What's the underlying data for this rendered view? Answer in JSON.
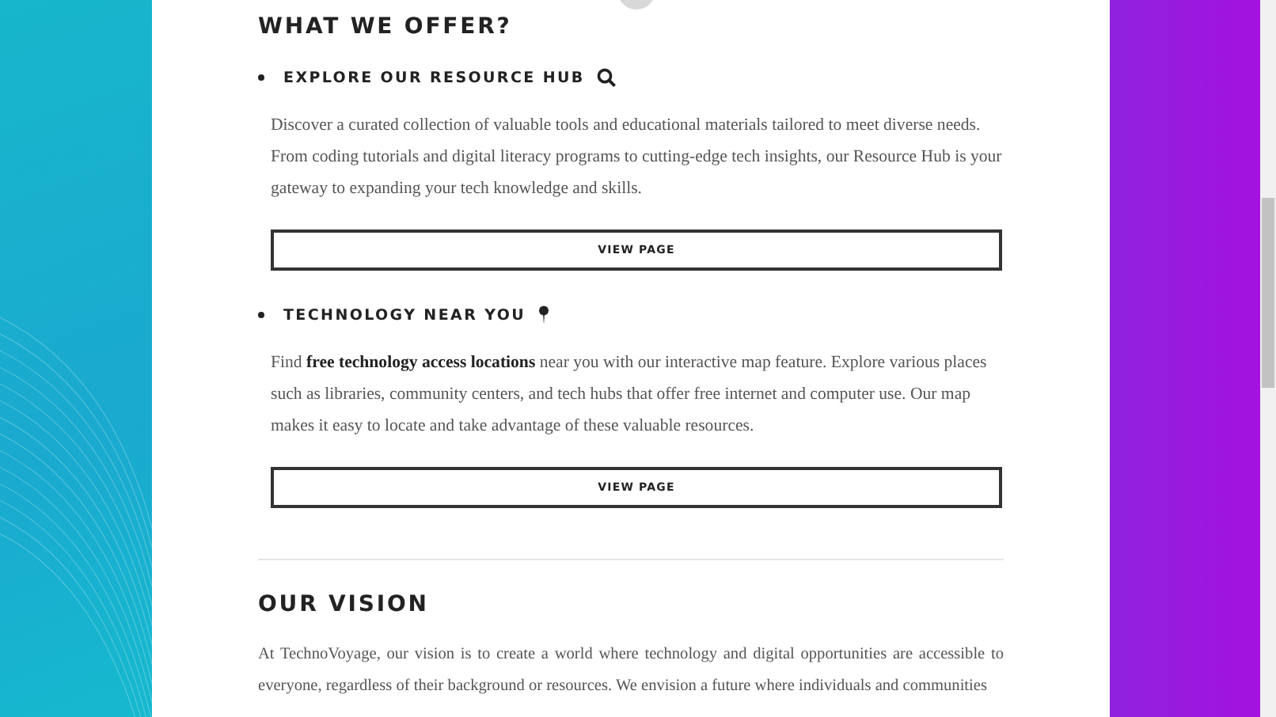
{
  "sections": [
    {
      "kind": "list",
      "heading": "WHAT WE OFFER?",
      "items": [
        {
          "title": "EXPLORE OUR RESOURCE HUB",
          "text": "Discover a curated collection of valuable tools and educational materials tailored to meet diverse needs. From coding tutorials and digital literacy programs to cutting-edge tech insights, our Resource Hub is your gateway to expanding your tech knowledge and skills.",
          "button": "VIEW PAGE"
        },
        {
          "title": "TECHNOLOGY NEAR YOU",
          "text": "Find **free technology access locations** near you with our interactive map feature. Explore various places such as libraries, community centers, and tech hubs that offer free internet and computer use. Our map makes it easy to locate and take advantage of these valuable resources.",
          "button": "VIEW PAGE"
        }
      ]
    },
    {
      "kind": "text",
      "heading": "OUR VISION",
      "text": "At TechnoVoyage, our vision is to create a world where technology and digital opportunities are accessible to everyone, regardless of their background or resources. We envision a future where individuals and communities"
    }
  ]
}
